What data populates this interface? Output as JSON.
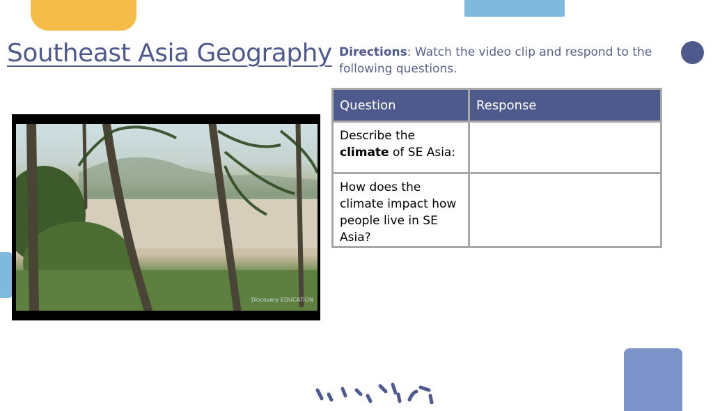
{
  "slide": {
    "title": "Southeast Asia Geography",
    "directions": {
      "label": "Directions",
      "text": ": Watch the video clip and respond to the following questions."
    },
    "table": {
      "headers": [
        "Question",
        "Response"
      ],
      "rows": [
        {
          "question_pre": "Describe the ",
          "question_bold": "climate",
          "question_post": " of SE Asia:",
          "response": ""
        },
        {
          "question_pre": "How does the climate impact how people live in SE Asia?",
          "response": ""
        }
      ]
    },
    "video": {
      "watermark": "Discovery EDUCATION"
    },
    "colors": {
      "navy": "#4f5a8c",
      "yellow": "#f6bc4a",
      "light_blue": "#7fb9dc",
      "periwinkle": "#7b93c9",
      "table_border": "#a7a7a7"
    }
  }
}
